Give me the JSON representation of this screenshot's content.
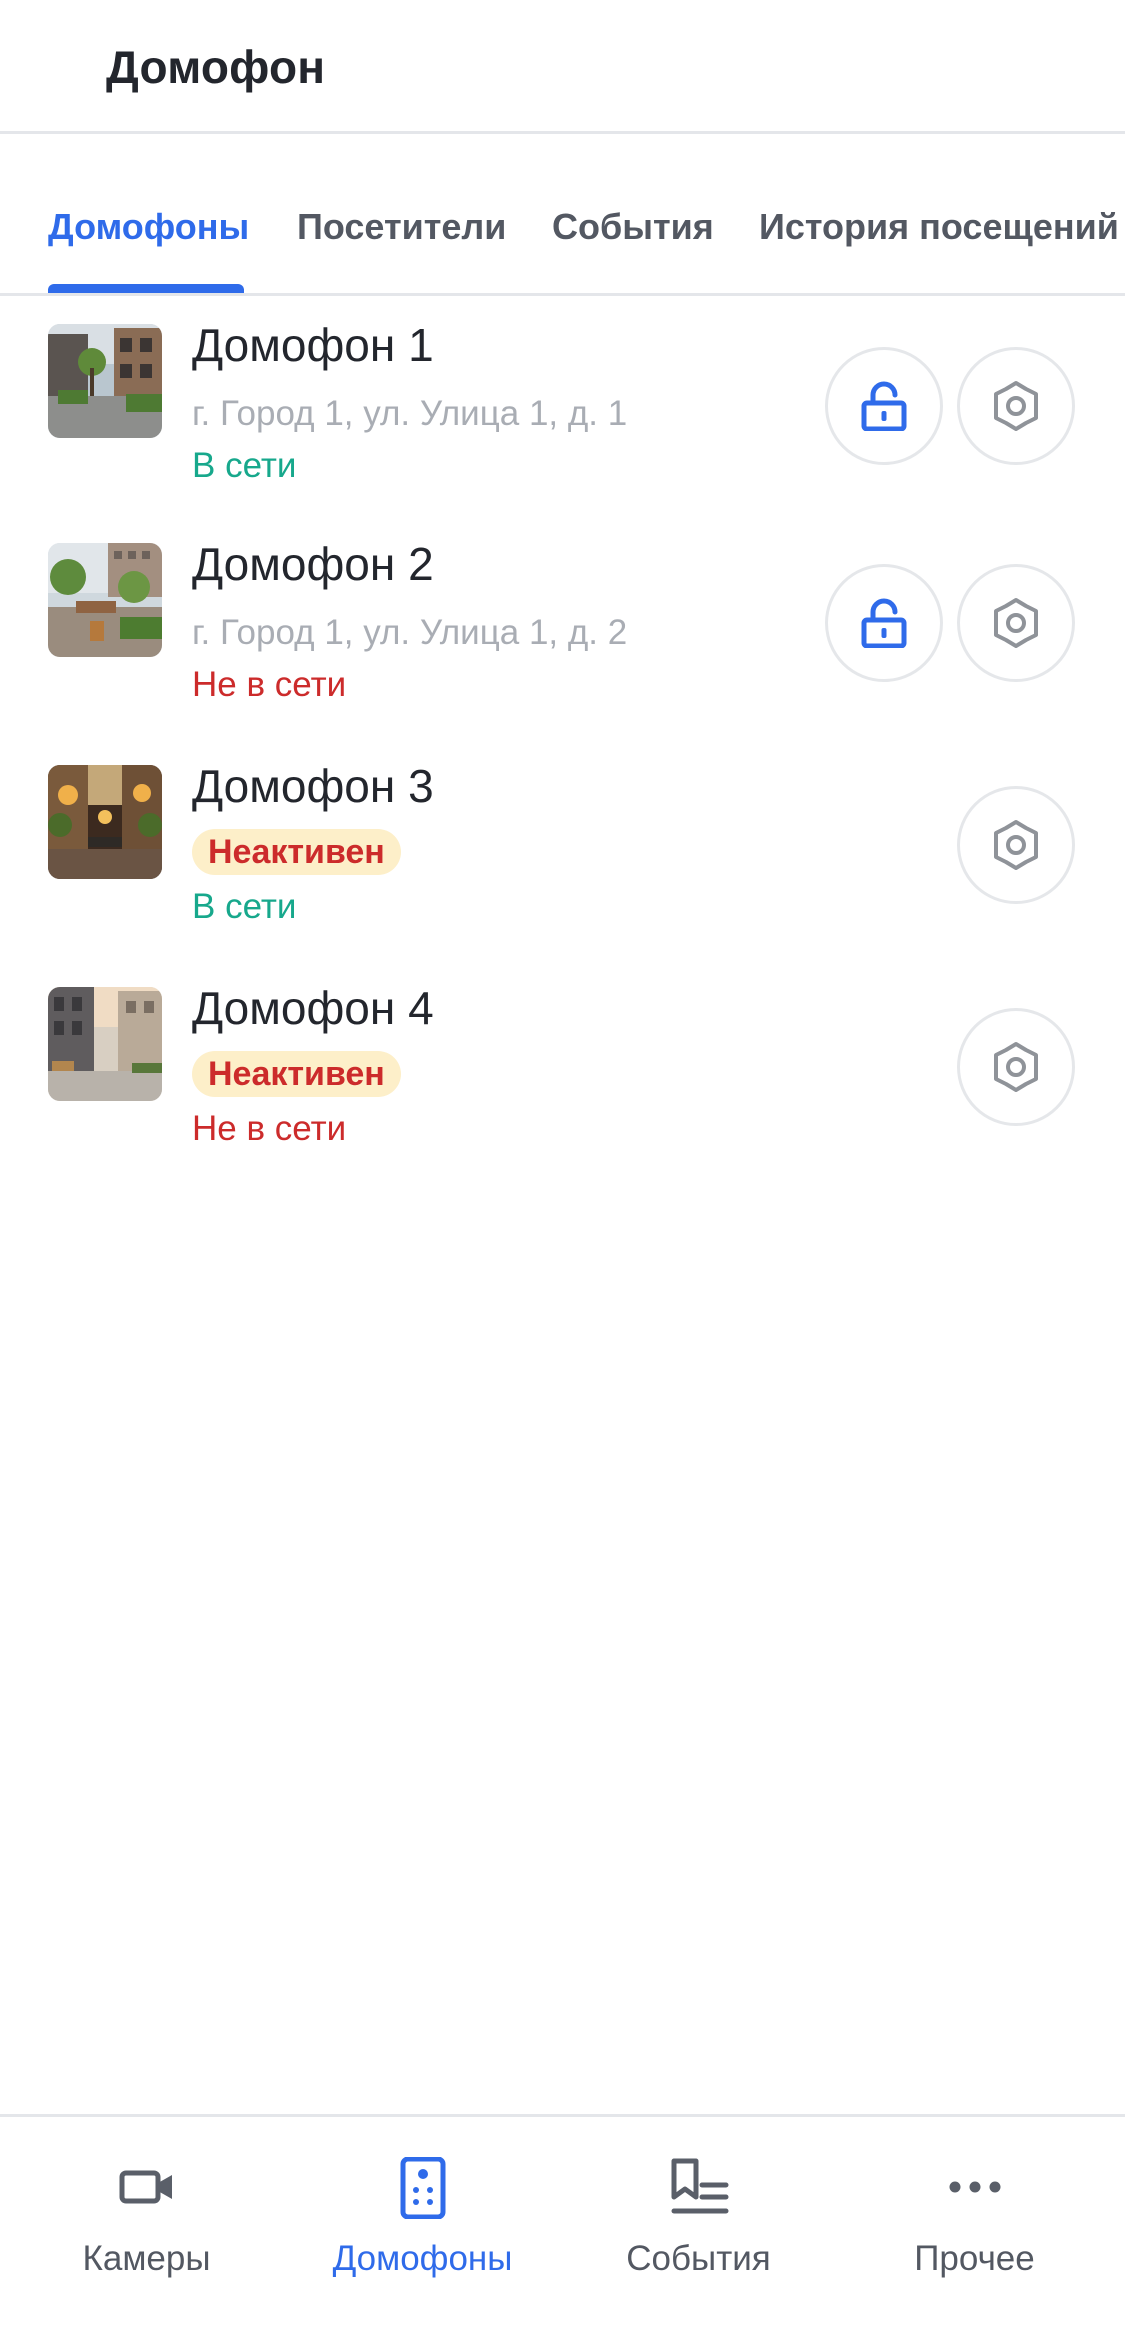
{
  "header": {
    "title": "Домофон"
  },
  "tabs": [
    {
      "label": "Домофоны",
      "active": true
    },
    {
      "label": "Посетители",
      "active": false
    },
    {
      "label": "События",
      "active": false
    },
    {
      "label": "История посещений",
      "active": false
    }
  ],
  "intercoms": [
    {
      "title": "Домофон 1",
      "address": "г. Город 1, ул. Улица 1, д. 1",
      "badge": "",
      "status": "В сети",
      "online": true,
      "has_unlock": true,
      "unlock_icon": "unlock-icon",
      "settings_icon": "gear-icon"
    },
    {
      "title": "Домофон 2",
      "address": "г. Город 1, ул. Улица 1, д. 2",
      "badge": "",
      "status": "Не в сети",
      "online": false,
      "has_unlock": true,
      "unlock_icon": "unlock-icon",
      "settings_icon": "gear-icon"
    },
    {
      "title": "Домофон 3",
      "address": "",
      "badge": "Неактивен",
      "status": "В сети",
      "online": true,
      "has_unlock": false,
      "settings_icon": "gear-icon"
    },
    {
      "title": "Домофон 4",
      "address": "",
      "badge": "Неактивен",
      "status": "Не в сети",
      "online": false,
      "has_unlock": false,
      "settings_icon": "gear-icon"
    }
  ],
  "bottom_nav": [
    {
      "label": "Камеры",
      "icon": "video-camera-icon",
      "active": false
    },
    {
      "label": "Домофоны",
      "icon": "intercom-icon",
      "active": true
    },
    {
      "label": "События",
      "icon": "events-list-icon",
      "active": false
    },
    {
      "label": "Прочее",
      "icon": "more-dots-icon",
      "active": false
    }
  ],
  "colors": {
    "accent": "#2f6bea",
    "online": "#17a88c",
    "offline": "#cc2b2b",
    "badge_bg": "#fdefc9",
    "text_primary": "#23262d",
    "text_secondary": "#a9adb4"
  }
}
